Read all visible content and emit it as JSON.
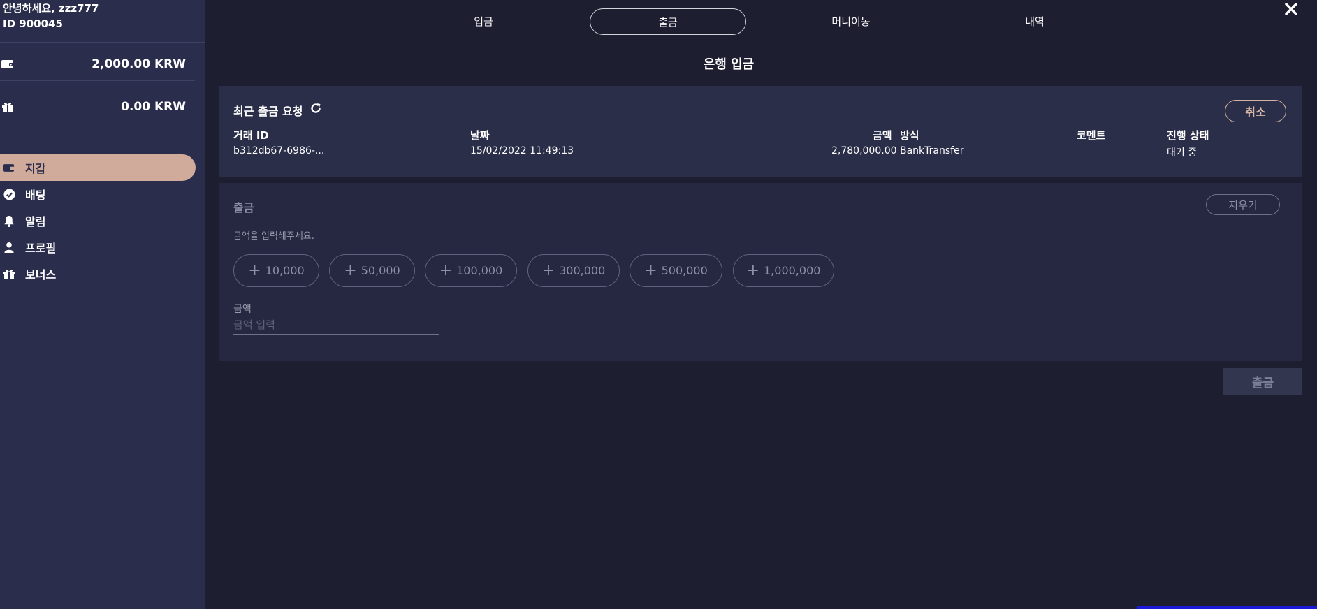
{
  "sidebar": {
    "greeting": "안녕하세요, zzz777",
    "user_id": "ID 900045",
    "balance": {
      "icon": "wallet-icon",
      "value": "2,000.00 KRW"
    },
    "bonus_balance": {
      "icon": "gift-icon",
      "value": "0.00 KRW"
    },
    "nav": [
      {
        "label": "지갑",
        "icon": "wallet-icon",
        "active": true
      },
      {
        "label": "배팅",
        "icon": "check-circle-icon",
        "active": false
      },
      {
        "label": "알림",
        "icon": "bell-icon",
        "active": false
      },
      {
        "label": "프로필",
        "icon": "user-icon",
        "active": false
      },
      {
        "label": "보너스",
        "icon": "gift-icon",
        "active": false
      }
    ]
  },
  "tabs": [
    {
      "label": "입금",
      "active": false
    },
    {
      "label": "출금",
      "active": true
    },
    {
      "label": "머니이동",
      "active": false
    },
    {
      "label": "내역",
      "active": false
    }
  ],
  "page_title": "은행 입금",
  "recent_request": {
    "title": "최근 출금 요청",
    "cancel_label": "취소",
    "columns": [
      "거래 ID",
      "날짜",
      "금액",
      "방식",
      "코멘트",
      "진행 상태"
    ],
    "row": {
      "transaction_id": "b312db67-6986-...",
      "date": "15/02/2022 11:49:13",
      "amount": "2,780,000.00",
      "method": "BankTransfer",
      "comment": "",
      "status": "대기 중"
    }
  },
  "withdraw_form": {
    "title": "출금",
    "clear_label": "지우기",
    "hint": "금액을 입력해주세요.",
    "quick_amounts": [
      "10,000",
      "50,000",
      "100,000",
      "300,000",
      "500,000",
      "1,000,000"
    ],
    "amount_label": "금액",
    "amount_placeholder": "금액 입력",
    "amount_value": ""
  },
  "submit_label": "출금",
  "colors": {
    "sidebar_bg": "#2a2e4c",
    "main_bg": "#1d1e30",
    "accent": "#d0ab9b"
  }
}
